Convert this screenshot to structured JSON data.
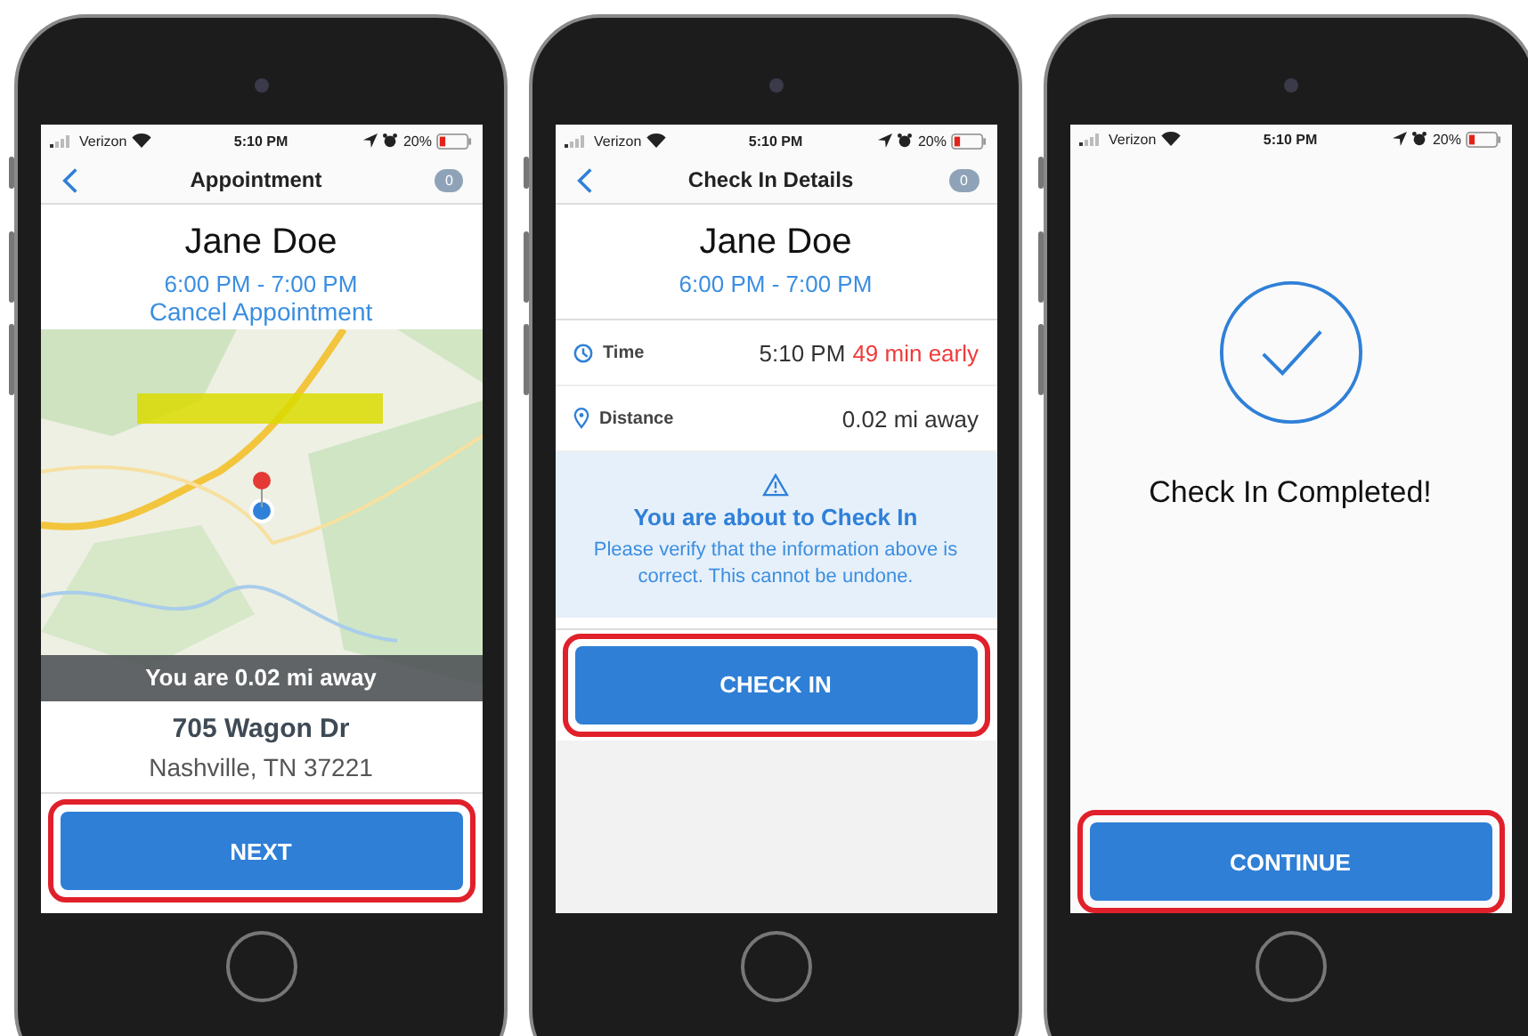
{
  "phones": [
    {
      "kind": "appointment",
      "status_bar": {
        "carrier": "Verizon",
        "time": "5:10 PM",
        "battery": "20%"
      },
      "nav": {
        "title": "Appointment",
        "badge": "0"
      },
      "name": "Jane Doe",
      "time_range": "6:00 PM - 7:00 PM",
      "cancel_link": "Cancel Appointment",
      "map": {
        "kind": "picture",
        "banner": "You are 0.02 mi away"
      },
      "address": "705 Wagon Dr",
      "city": "Nashville, TN 37221",
      "button": "NEXT"
    },
    {
      "kind": "details",
      "status_bar": {
        "carrier": "Verizon",
        "time": "5:10 PM",
        "battery": "20%"
      },
      "nav": {
        "title": "Check In Details",
        "badge": "0"
      },
      "name": "Jane Doe",
      "time_range": "6:00 PM - 7:00 PM",
      "rows": [
        {
          "kind": "time",
          "label": "Time",
          "value": "5:10 PM",
          "note": "49 min early"
        },
        {
          "kind": "distance",
          "label": "Distance",
          "value": "0.02 mi away"
        }
      ],
      "notice": {
        "title": "You are about to Check In",
        "text": "Please verify that the information above is correct. This cannot be undone."
      },
      "button": "CHECK IN"
    },
    {
      "kind": "completed",
      "status_bar": {
        "carrier": "Verizon",
        "time": "5:10 PM",
        "battery": "20%"
      },
      "message": "Check In Completed!",
      "button": "CONTINUE"
    }
  ]
}
